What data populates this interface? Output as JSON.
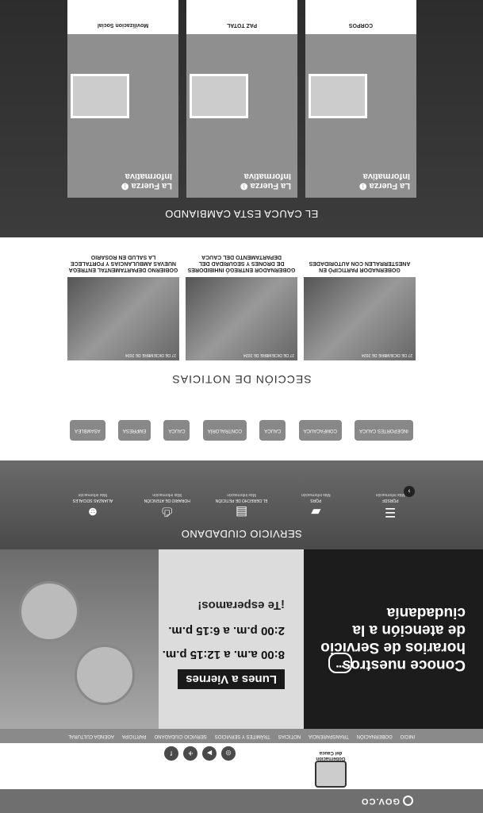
{
  "gov": {
    "logo": "GOV.CO"
  },
  "header": {
    "logo_lines": [
      "Gobernación",
      "del Cauca"
    ],
    "social": [
      {
        "name": "instagram",
        "glyph": "◎"
      },
      {
        "name": "youtube",
        "glyph": "▶"
      },
      {
        "name": "twitter",
        "glyph": "✈"
      },
      {
        "name": "facebook",
        "glyph": "f"
      }
    ]
  },
  "nav": {
    "items": [
      "INICIO",
      "GOBERNACIÓN",
      "TRANSPARENCIA",
      "NOTICIAS",
      "TRÁMITES Y SERVICIOS",
      "SERVICIO CIUDADANO",
      "PARTICIPA",
      "AGENDA CULTURAL"
    ]
  },
  "banner": {
    "title_lines": [
      "Conoce nuestros",
      "horarios de Servicio",
      "de atención a la",
      "ciudadanía"
    ],
    "days": "Lunes a Viernes",
    "hours": [
      "8:00 a.m. a 12:15 p.m.",
      "2:00 p.m. a 6:15 p.m."
    ],
    "wait": "¡Te esperamos!"
  },
  "servicio": {
    "title": "SERVICIO CIUDADANO",
    "items": [
      {
        "label": "PQRSDF",
        "icon": "database-icon",
        "glyph": "☰",
        "more": "Más información"
      },
      {
        "label": "PQRS",
        "icon": "folder-icon",
        "glyph": "▰",
        "more": "Más información"
      },
      {
        "label": "EL DERECHO DE PETICIÓN",
        "icon": "document-icon",
        "glyph": "▤",
        "more": "Más información"
      },
      {
        "label": "HORARIO DE ATENCIÓN",
        "icon": "printer-icon",
        "glyph": "⎙",
        "more": "Más información"
      },
      {
        "label": "ALIANZAS SOCIALES",
        "icon": "people-icon",
        "glyph": "☻",
        "more": "Más información"
      }
    ]
  },
  "aliados": [
    "INDEPORTES CAUCA",
    "COMFACAUCA",
    "CAUCA",
    "CONTRALORÍA",
    "CAUCA",
    "EMPRESA",
    "ASAMBLEA"
  ],
  "noticias": {
    "title": "SECCIÓN DE NOTICIAS",
    "items": [
      {
        "title": "GOBERNADOR PARTICIPÓ EN ANESTERRALEN CON AUTORIDADES",
        "date": "27 DE DICIEMBRE DE 2024"
      },
      {
        "title": "GOBERNADOR ENTREGÓ INHIBIDORES DE DRONES Y SEGURIDAD DEL DEPARTAMENTO DEL CAUCA",
        "date": "27 DE DICIEMBRE DE 2024"
      },
      {
        "title": "GOBIERNO DEPARTAMENTAL ENTREGA NUEVAS AMBULANCIAS Y FORTALECE LA SALUD EN ROSARIO",
        "date": "27 DE DICIEMBRE DE 2024"
      }
    ]
  },
  "cauca": {
    "title": "EL CAUCA ESTA CAMBIANDO",
    "cards": [
      {
        "head": "La Fuerza ❶ Informativa",
        "foot_title": "CORPOS",
        "badge": "#LaFuerza"
      },
      {
        "head": "La Fuerza ❶ Informativa",
        "foot_title": "PAZ TOTAL",
        "badge": "#LaFuerza"
      },
      {
        "head": "La Fuerza ❶ Informativa",
        "foot_title": "Movilizacion Social",
        "badge": "#LaFuerza"
      }
    ]
  }
}
